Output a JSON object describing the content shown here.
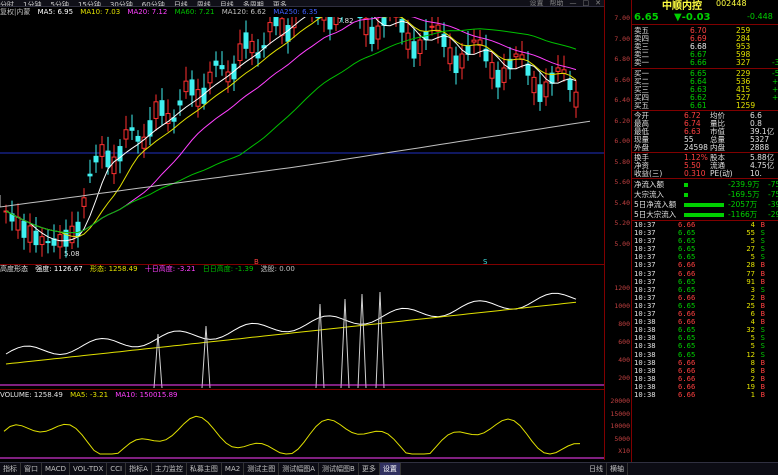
{
  "top_menu": [
    "分时",
    "1分钟",
    "5分钟",
    "15分钟",
    "30分钟",
    "60分钟",
    "日线",
    "周线",
    "月线",
    "多周期",
    "更多"
  ],
  "window_controls": [
    "设置",
    "帮助",
    "—",
    "□",
    "✕"
  ],
  "indicator_bar": {
    "label": "复权|内蒙",
    "ma5": "MA5: 6.95",
    "ma10": "MA10: 7.03",
    "ma20": "MA20: 7.12",
    "ma60": "MA60: 7.21",
    "ma120": "MA120: 6.62",
    "ma250": "MA250: 6.35",
    "colors": {
      "ma5": "#ffffff",
      "ma10": "#e0e000",
      "ma20": "#ff40ff",
      "ma60": "#00c000",
      "ma120": "#c0c0c0",
      "ma250": "#4060ff"
    }
  },
  "main_chart": {
    "high_label": "7.82",
    "low_label": "5.08",
    "marker_b": "B",
    "marker_s": "S",
    "y_ticks": [
      "7.00",
      "7.00",
      "6.80",
      "6.60",
      "6.40",
      "6.20",
      "6.00",
      "5.80",
      "5.60",
      "5.40",
      "5.20",
      "5.00"
    ]
  },
  "sub1": {
    "title": "高度形态",
    "values": [
      "强度: 1126.67",
      "形态: 1258.49",
      "十日高度: -3.21",
      "日日高度: -1.39",
      "选股: 0.00"
    ],
    "y_ticks": [
      "1200",
      "1000",
      "800",
      "600",
      "400",
      "200"
    ]
  },
  "sub2": {
    "title": "VOLUME: 1258.49",
    "values": [
      "MA5: -3.21",
      "MA10: 150015.89"
    ],
    "y_ticks": [
      "20000",
      "15000",
      "10000",
      "5000",
      "X10"
    ]
  },
  "bottom_tabs": [
    "指标",
    "窗口",
    "MACD",
    "VOL-TDX",
    "CCI",
    "指标A",
    "主力监控",
    "私募主图",
    "MA2",
    "测试主图",
    "测试幅图A",
    "测试幅图B",
    "更多",
    "设置"
  ],
  "bottom_right_tabs": [
    "日线",
    "横轴"
  ],
  "quote": {
    "name": "中顺内控",
    "code": "002448",
    "price": "6.65",
    "change": "▼-0.03",
    "change_pct": "-0.448",
    "sell": [
      {
        "label": "卖五",
        "price": "6.70",
        "vol": "259"
      },
      {
        "label": "卖四",
        "price": "6.69",
        "vol": "284"
      },
      {
        "label": "卖三",
        "price": "6.68",
        "vol": "953"
      },
      {
        "label": "卖二",
        "price": "6.67",
        "vol": "598"
      },
      {
        "label": "卖一",
        "price": "6.66",
        "vol": "327",
        "extra": "-3"
      }
    ],
    "buy": [
      {
        "label": "买一",
        "price": "6.65",
        "vol": "229",
        "extra": "-5"
      },
      {
        "label": "买二",
        "price": "6.64",
        "vol": "536",
        "extra": "+"
      },
      {
        "label": "买三",
        "price": "6.63",
        "vol": "415",
        "extra": "+"
      },
      {
        "label": "买四",
        "price": "6.62",
        "vol": "527",
        "extra": "+"
      },
      {
        "label": "买五",
        "price": "6.61",
        "vol": "1259",
        "extra": ""
      }
    ],
    "stats": [
      {
        "l1": "今开",
        "v1": "6.72",
        "l2": "均价",
        "v2": "6.6"
      },
      {
        "l1": "最高",
        "v1": "6.74",
        "l2": "量比",
        "v2": "0.8"
      },
      {
        "l1": "最低",
        "v1": "6.63",
        "l2": "市值",
        "v2": "39.1亿"
      },
      {
        "l1": "现量",
        "v1": "55",
        "l2": "总量",
        "v2": "5327"
      },
      {
        "l1": "外盘",
        "v1": "24598",
        "l2": "内盘",
        "v2": "2888"
      }
    ],
    "stats2": [
      {
        "l1": "换手",
        "v1": "1.12%",
        "l2": "股本",
        "v2": "5.88亿"
      },
      {
        "l1": "净资",
        "v1": "5.50",
        "l2": "流通",
        "v2": "4.75亿"
      },
      {
        "l1": "收益(三)",
        "v1": "0.310",
        "l2": "PE(动)",
        "v2": "10."
      }
    ],
    "flows": [
      {
        "label": "净流入额",
        "value": "-239.9万",
        "pct": "-75"
      },
      {
        "label": "大宗流入",
        "value": "-169.5万",
        "pct": "-75"
      },
      {
        "label": "5日净流入额",
        "value": "-2057万",
        "pct": "-39"
      },
      {
        "label": "5日大宗流入",
        "value": "-1166万",
        "pct": "-29"
      }
    ],
    "ticks": [
      [
        "10:37",
        "6.66",
        "4",
        "B"
      ],
      [
        "10:37",
        "6.65",
        "55",
        "S"
      ],
      [
        "10:37",
        "6.65",
        "5",
        "S"
      ],
      [
        "10:37",
        "6.65",
        "27",
        "S"
      ],
      [
        "10:37",
        "6.65",
        "5",
        "S"
      ],
      [
        "10:37",
        "6.66",
        "28",
        "B"
      ],
      [
        "10:37",
        "6.66",
        "77",
        "B"
      ],
      [
        "10:37",
        "6.65",
        "91",
        "B"
      ],
      [
        "10:37",
        "6.65",
        "3",
        "S"
      ],
      [
        "10:37",
        "6.66",
        "2",
        "B"
      ],
      [
        "10:37",
        "6.65",
        "25",
        "B"
      ],
      [
        "10:37",
        "6.66",
        "6",
        "B"
      ],
      [
        "10:38",
        "6.66",
        "4",
        "B"
      ],
      [
        "10:38",
        "6.65",
        "32",
        "S"
      ],
      [
        "10:38",
        "6.65",
        "5",
        "S"
      ],
      [
        "10:38",
        "6.65",
        "5",
        "S"
      ],
      [
        "10:38",
        "6.65",
        "12",
        "S"
      ],
      [
        "10:38",
        "6.66",
        "8",
        "B"
      ],
      [
        "10:38",
        "6.66",
        "8",
        "B"
      ],
      [
        "10:38",
        "6.66",
        "2",
        "B"
      ],
      [
        "10:38",
        "6.66",
        "19",
        "B"
      ],
      [
        "10:38",
        "6.66",
        "1",
        "B"
      ]
    ]
  }
}
